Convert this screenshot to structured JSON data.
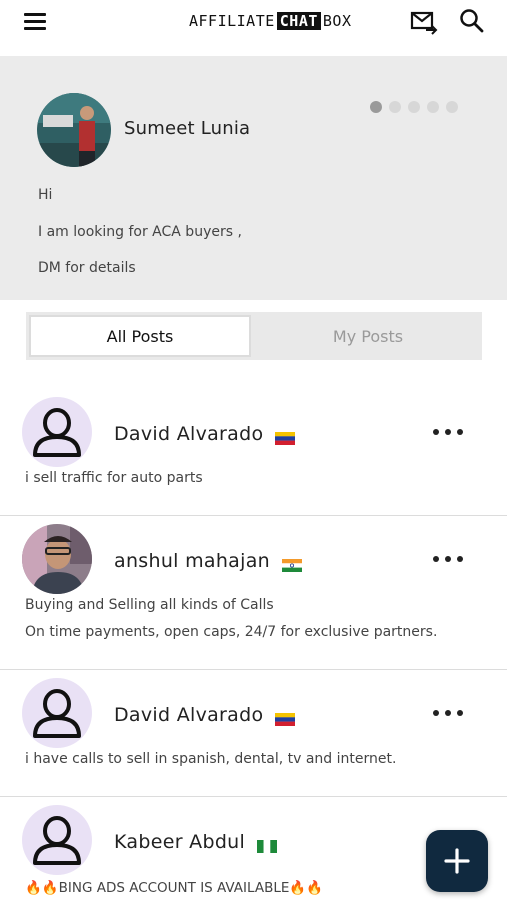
{
  "header": {
    "logo_left": "AFFILIATE",
    "logo_mid": "CHAT",
    "logo_right": "BOX"
  },
  "banner": {
    "name": "Sumeet Lunia",
    "lines": [
      "Hi",
      "I am looking for ACA buyers ,",
      "DM for details"
    ],
    "carousel_dots": 5,
    "active_dot": 0
  },
  "tabs": {
    "all_posts": "All Posts",
    "my_posts": "My Posts",
    "selected": "all_posts"
  },
  "posts": [
    {
      "name": "David Alvarado",
      "flag": "venezuela-flag",
      "avatar": "placeholder",
      "lines": [
        "i sell traffic for auto parts"
      ]
    },
    {
      "name": "anshul mahajan",
      "flag": "india-flag",
      "avatar": "photo",
      "lines": [
        "Buying and Selling all kinds of Calls",
        "On time payments, open caps, 24/7 for exclusive partners."
      ]
    },
    {
      "name": "David Alvarado",
      "flag": "venezuela-flag",
      "avatar": "placeholder",
      "lines": [
        "i have calls to sell in spanish, dental, tv and internet."
      ]
    },
    {
      "name": "Kabeer Abdul",
      "flag": "nigeria-flag",
      "avatar": "placeholder",
      "lines": [
        "🔥🔥BING ADS ACCOUNT IS AVAILABLE🔥🔥"
      ]
    }
  ],
  "colors": {
    "fab": "#10293f",
    "placeholder_avatar_bg": "#e9e1f5",
    "banner_bg": "#ebebeb"
  }
}
